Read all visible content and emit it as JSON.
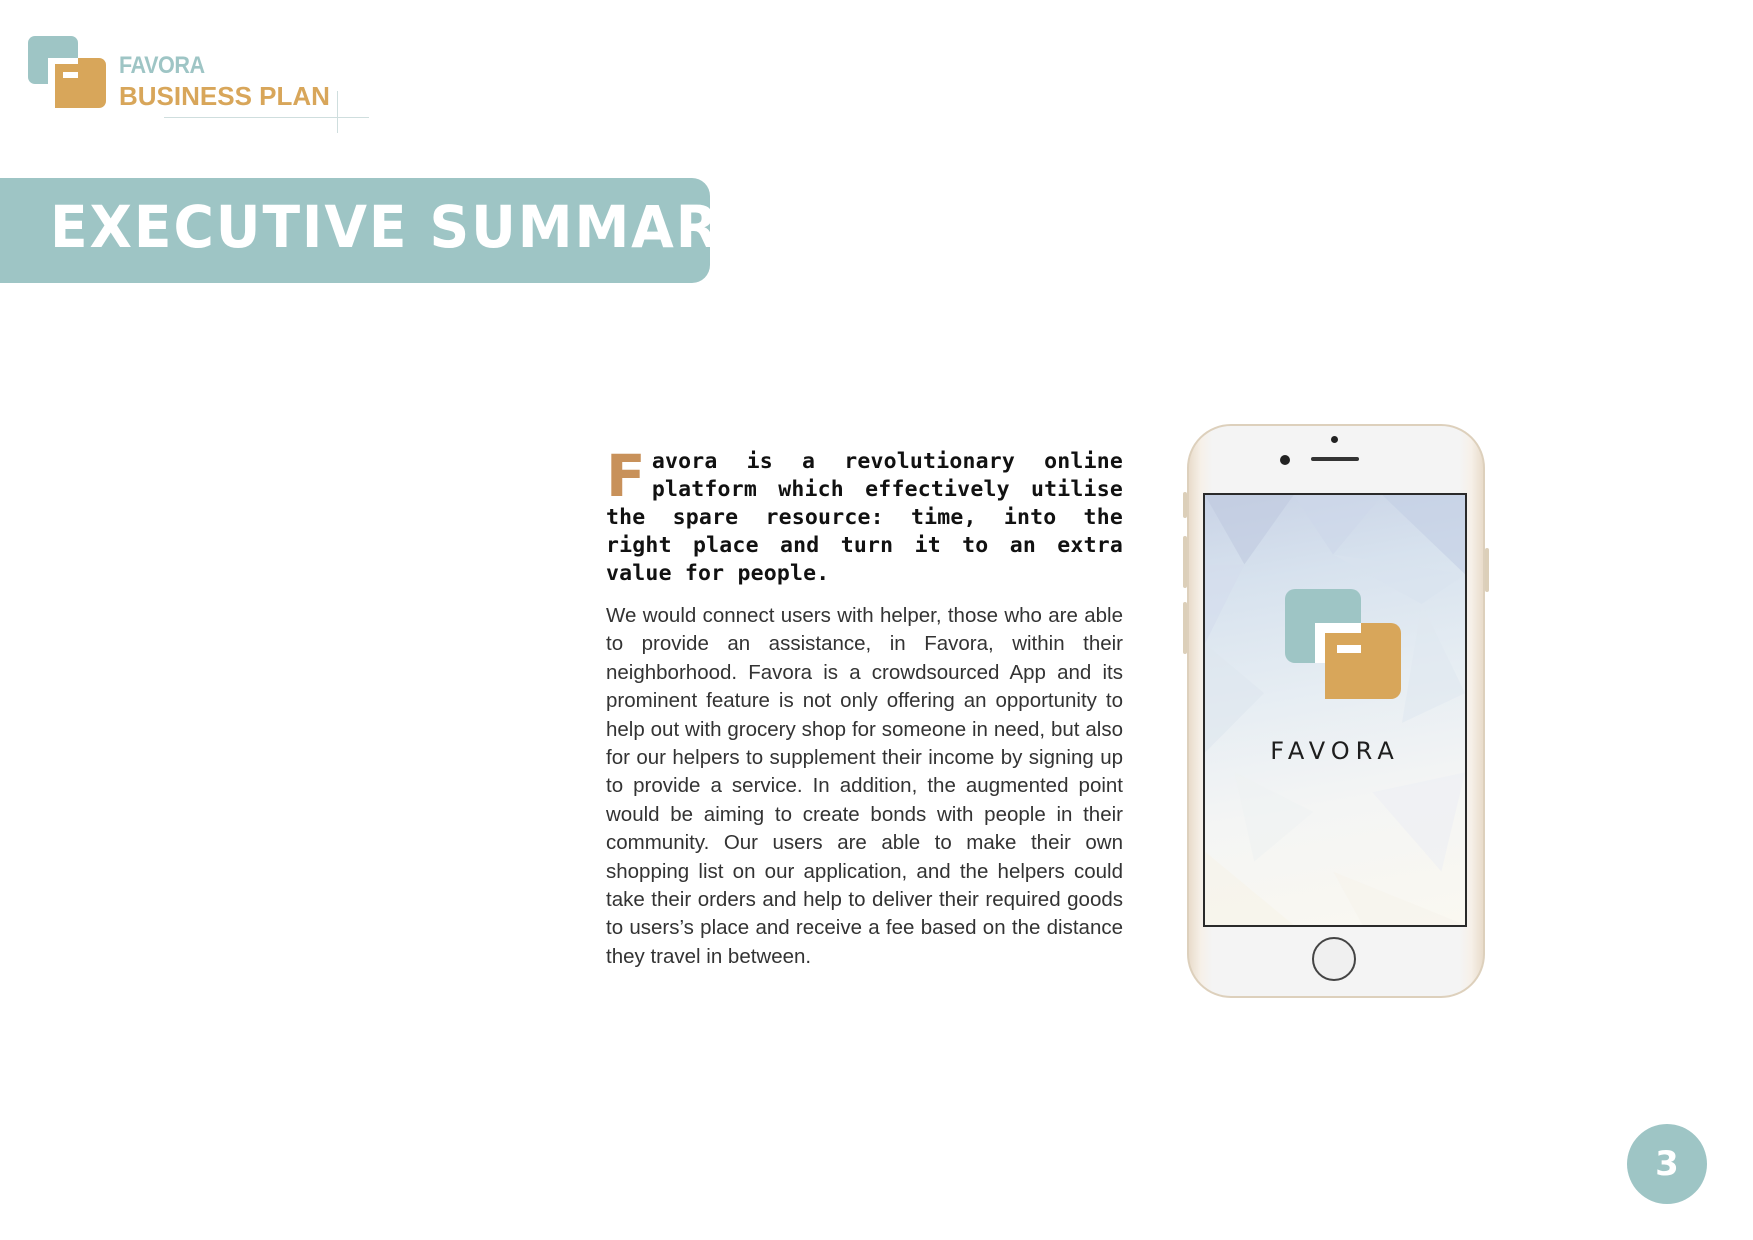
{
  "header": {
    "brand_name": "FAVORA",
    "brand_subtitle": "BUSINESS PLAN",
    "logo_icon": "favora-logo-icon"
  },
  "banner": {
    "title": "EXECUTIVE SUMMARY"
  },
  "lead": {
    "drop_cap": "F",
    "text": "avora is a revolutionary online platform which effectively utilise the spare resource: time, into the right place and turn it to an extra value for people."
  },
  "body": {
    "text": "We would connect users with helper, those who are able to provide an assistance, in Favora, within their neighborhood. Favora is a crowdsourced App and its prominent feature is not only offering an opportunity to help out with grocery shop for someone in need, but also for our helpers to supplement their income by signing up to provide a service. In addition, the augmented point would be aiming to create bonds with people in their community. Our users are able to make their own shopping list on our application, and the helpers could take their orders and help to deliver their required goods to users’s place and receive a fee based on the distance they travel in between."
  },
  "phone": {
    "app_name": "FAVORA",
    "app_logo_icon": "favora-logo-icon"
  },
  "footer": {
    "page_number": "3"
  },
  "colors": {
    "teal": "#9ec5c5",
    "gold": "#d8a65a",
    "drop_cap": "#c8915a"
  }
}
